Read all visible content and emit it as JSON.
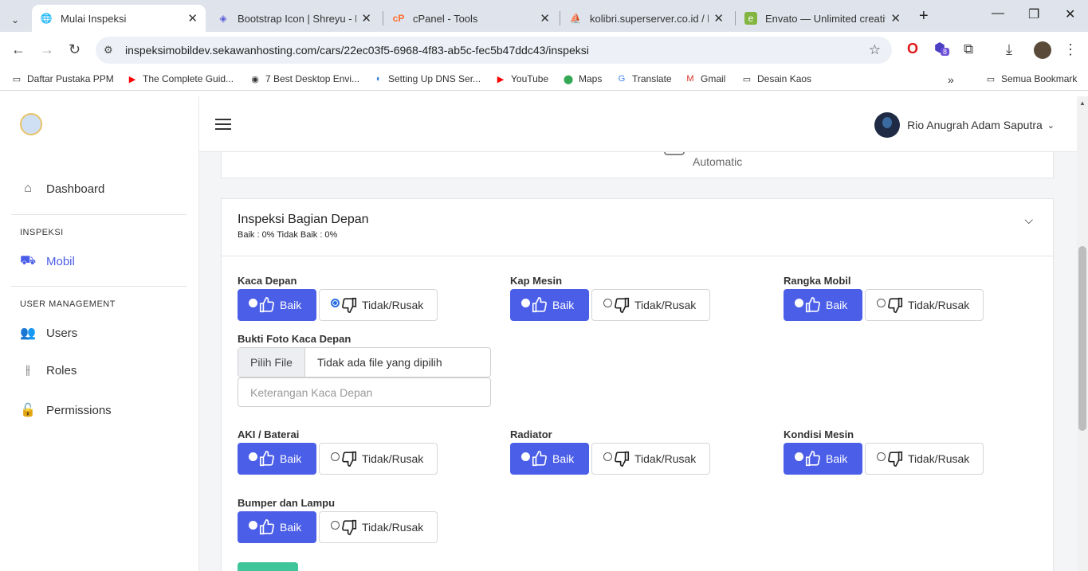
{
  "browser": {
    "tabs": [
      {
        "title": "Mulai Inspeksi",
        "active": true
      },
      {
        "title": "Bootstrap Icon | Shreyu - Re",
        "active": false
      },
      {
        "title": "cPanel - Tools",
        "active": false
      },
      {
        "title": "kolibri.superserver.co.id / lo",
        "active": false
      },
      {
        "title": "Envato — Unlimited creative",
        "active": false
      }
    ],
    "url": "inspeksimobildev.sekawanhosting.com/cars/22ec03f5-6968-4f83-ab5c-fec5b47ddc43/inspeksi",
    "extension_badge": "8",
    "bookmarks": [
      "Daftar Pustaka PPM",
      "The Complete Guid...",
      "7 Best Desktop Envi...",
      "Setting Up DNS Ser...",
      "YouTube",
      "Maps",
      "Translate",
      "Gmail",
      "Desain Kaos"
    ],
    "all_bookmarks": "Semua Bookmark"
  },
  "sidebar": {
    "dashboard": "Dashboard",
    "section_inspeksi": "INSPEKSI",
    "mobil": "Mobil",
    "section_user": "USER MANAGEMENT",
    "users": "Users",
    "roles": "Roles",
    "permissions": "Permissions"
  },
  "header": {
    "user_name": "Rio Anugrah Adam Saputra"
  },
  "top_card": {
    "transmission": "Automatic"
  },
  "section": {
    "title": "Inspeksi Bagian Depan",
    "summary": "Baik : 0% Tidak Baik : 0%"
  },
  "options": {
    "good": "Baik",
    "bad": "Tidak/Rusak"
  },
  "fields": [
    {
      "label": "Kaca Depan",
      "selected": "bad"
    },
    {
      "label": "Kap Mesin",
      "selected": "good"
    },
    {
      "label": "Rangka Mobil",
      "selected": "good"
    },
    {
      "label": "AKI / Baterai",
      "selected": "good"
    },
    {
      "label": "Radiator",
      "selected": "good"
    },
    {
      "label": "Kondisi Mesin",
      "selected": "good"
    },
    {
      "label": "Bumper dan Lampu",
      "selected": "good"
    }
  ],
  "photo": {
    "label": "Bukti Foto Kaca Depan",
    "button": "Pilih File",
    "no_file": "Tidak ada file yang dipilih",
    "note_placeholder": "Keterangan Kaca Depan"
  }
}
